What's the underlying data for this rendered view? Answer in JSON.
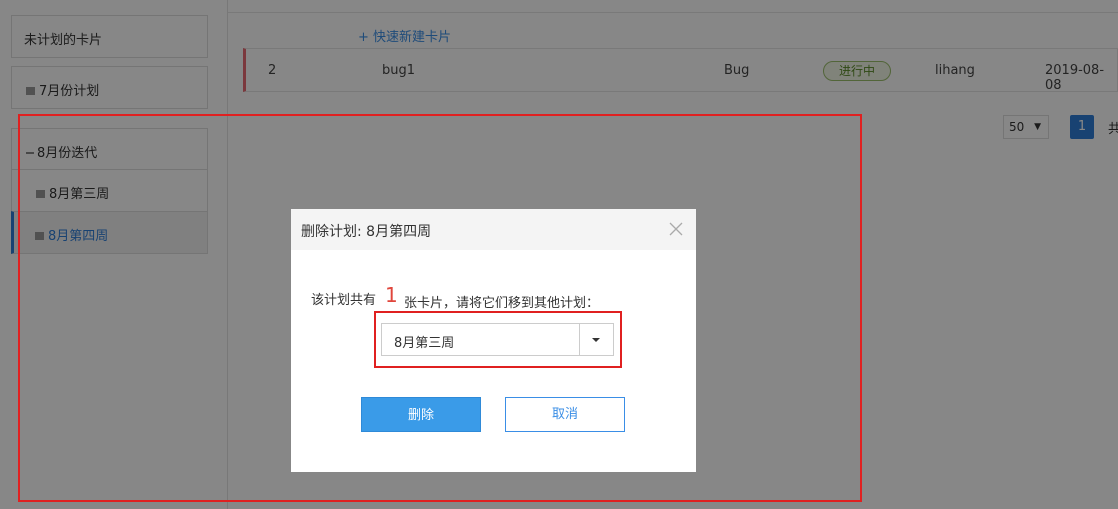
{
  "sidebar": {
    "unplanned": "未计划的卡片",
    "july_plan": "7月份计划",
    "aug_iteration": "8月份迭代",
    "week3": "8月第三周",
    "week4": "8月第四周"
  },
  "main": {
    "quick_add": "+  快速新建卡片",
    "card": {
      "index": "2",
      "title": "bug1",
      "type": "Bug",
      "status": "进行中",
      "owner": "lihang",
      "date": "2019-08-08"
    },
    "pager": {
      "page_size": "50",
      "current_page": "1",
      "total_prefix": "共"
    }
  },
  "modal": {
    "title": "删除计划: 8月第四周",
    "message_prefix": "该计划共有",
    "count": "1",
    "message_suffix": "张卡片，请将它们移到其他计划：",
    "selected_plan": "8月第三周",
    "delete_label": "删除",
    "cancel_label": "取消"
  },
  "colors": {
    "accent": "#2f7ed8",
    "highlight": "#e02020",
    "status": "#5a8a27"
  }
}
